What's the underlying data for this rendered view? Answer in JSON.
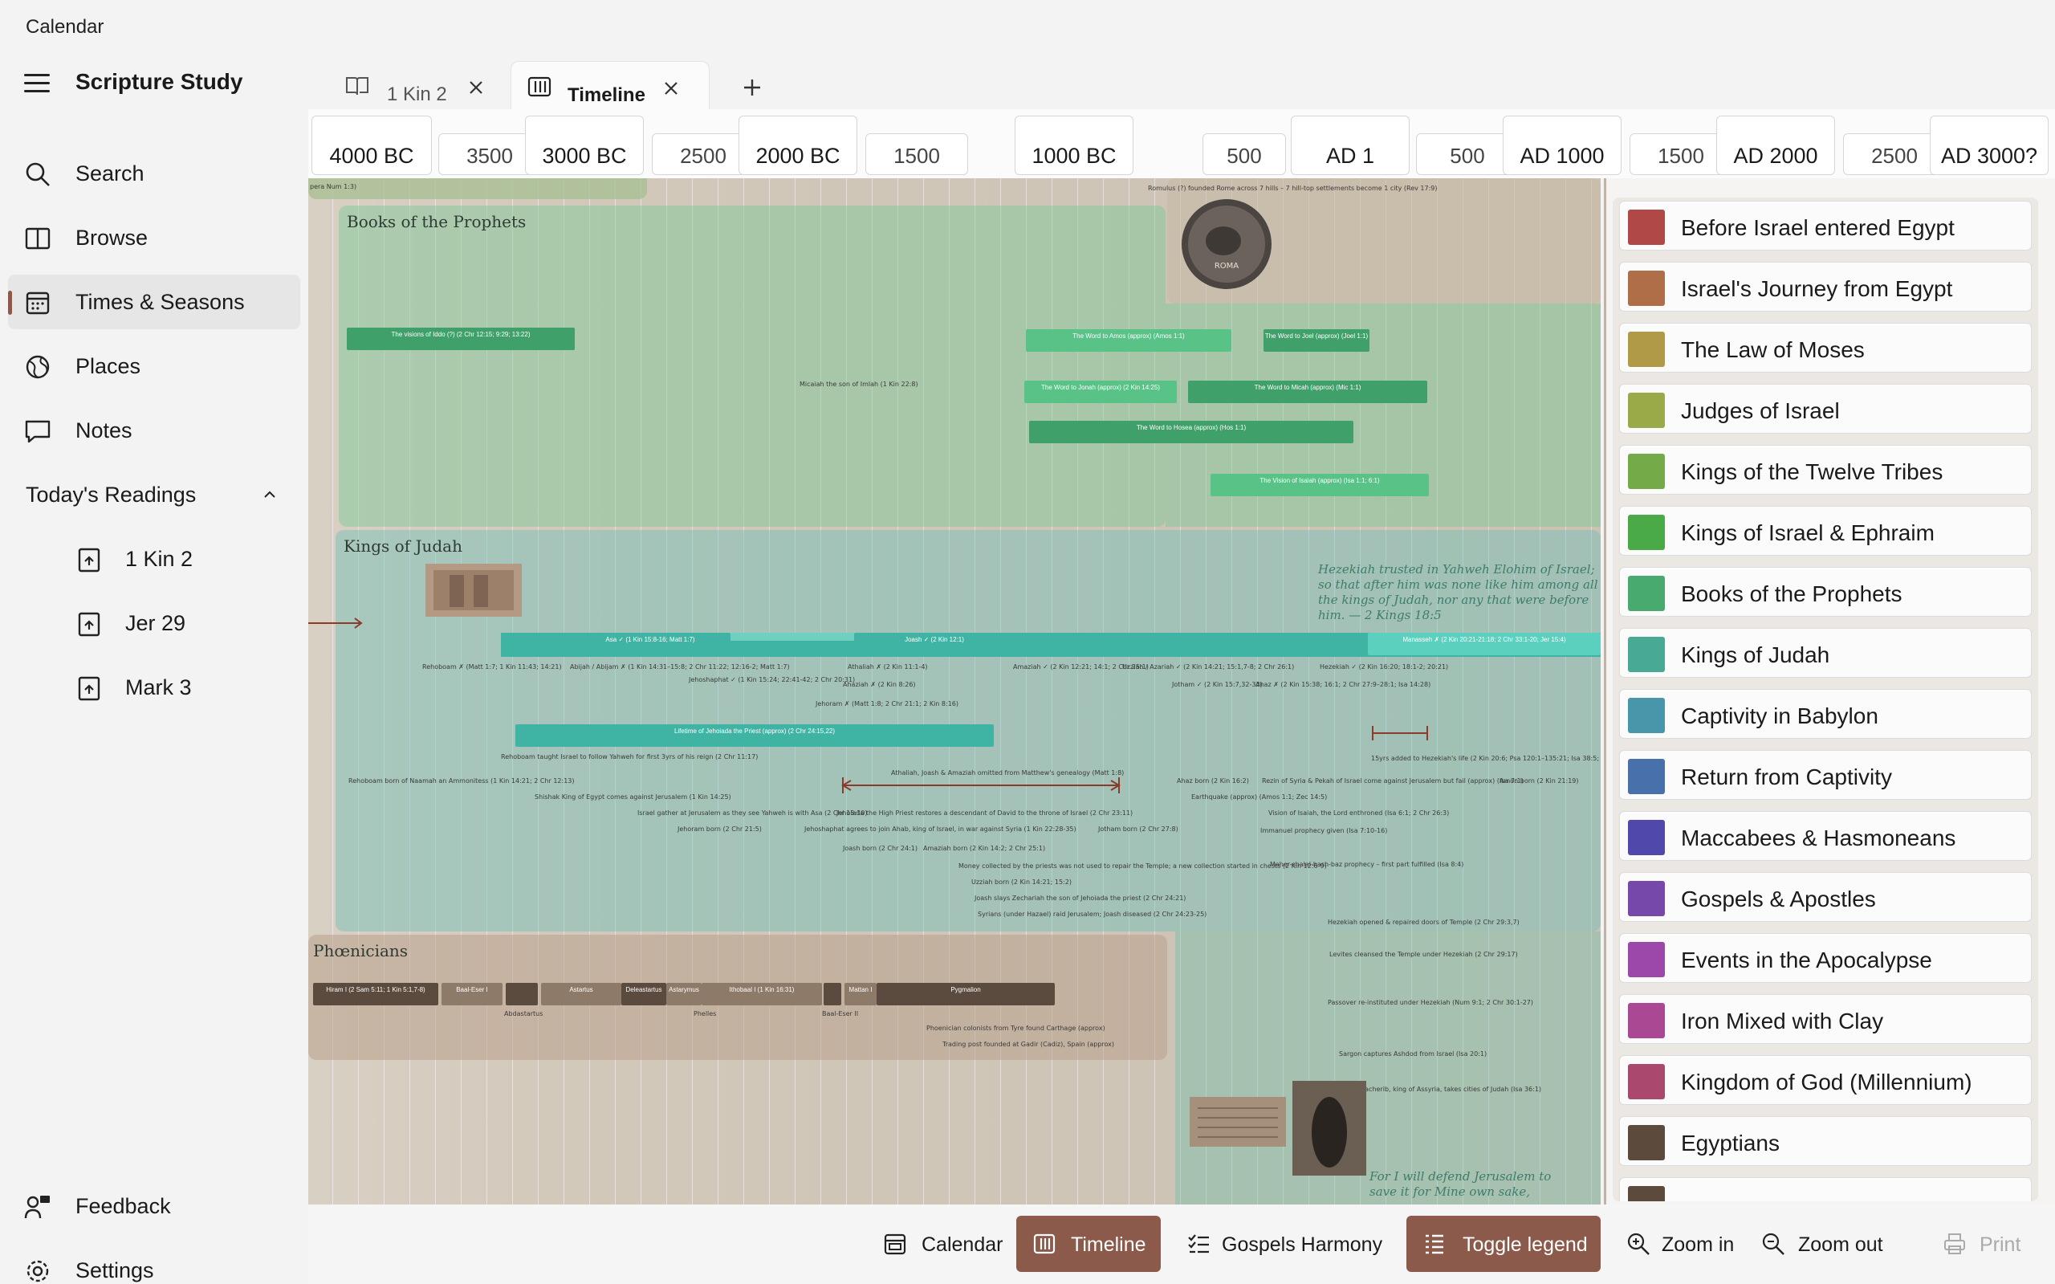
{
  "window": {
    "title": "Calendar"
  },
  "sidebar": {
    "title": "Scripture Study",
    "nav": [
      {
        "label": "Search",
        "icon": "search-icon"
      },
      {
        "label": "Browse",
        "icon": "book-icon"
      },
      {
        "label": "Times & Seasons",
        "icon": "calendar-icon",
        "active": true
      },
      {
        "label": "Places",
        "icon": "globe-icon"
      },
      {
        "label": "Notes",
        "icon": "note-icon"
      }
    ],
    "readings_header": "Today's Readings",
    "readings": [
      {
        "label": "1 Kin 2",
        "icon": "reading-icon"
      },
      {
        "label": "Jer 29",
        "icon": "reading-icon"
      },
      {
        "label": "Mark 3",
        "icon": "reading-icon"
      }
    ],
    "footer": [
      {
        "label": "Feedback",
        "icon": "feedback-icon"
      },
      {
        "label": "Settings",
        "icon": "gear-icon"
      }
    ]
  },
  "tabs": [
    {
      "label": "1 Kin 2",
      "icon": "book-open-icon",
      "active": false
    },
    {
      "label": "Timeline",
      "icon": "timeline-icon",
      "active": true
    }
  ],
  "eras": {
    "major": [
      "4000 BC",
      "3000 BC",
      "2000 BC",
      "1000 BC",
      "AD 1",
      "AD 1000",
      "AD 2000",
      "AD 3000?"
    ],
    "minor": [
      "3500",
      "2500",
      "1500",
      "500",
      "500",
      "1500",
      "2500"
    ]
  },
  "timeline": {
    "bands": {
      "prophets": "Books of the Prophets",
      "judah": "Kings of Judah",
      "phoenicians": "Phœnicians"
    },
    "quotes": {
      "hezekiah": "Hezekiah trusted in Yahweh Elohim of Israel; so that after him was none like him among all the kings of Judah, nor any that were before him. — 2 Kings 18:5",
      "defend": "For I will defend Jerusalem to save it for Mine own sake,"
    },
    "prophet_bars": [
      "The visions of Iddo (?) (2 Chr 12:15; 9:29; 13:22)",
      "The Word to Amos (approx) (Amos 1:1)",
      "The Word to Joel (approx) (Joel 1:1)",
      "The Word to Jonah (approx) (2 Kin 14:25)",
      "The Word to Micah (approx) (Mic 1:1)",
      "The Word to Hosea (approx) (Hos 1:1)",
      "The Vision of Isaiah (approx) (Isa 1:1; 6:1)"
    ],
    "judah_bars": [
      "Asa ✓ (1 Kin 15:8-16; Matt 1:7)",
      "Joash ✓ (2 Kin 12:1)",
      "Manasseh ✗ (2 Kin 20:21-21:18; 2 Chr 33:1-20; Jer 15:4)",
      "Lifetime of Jehoiada the Priest (approx) (2 Chr 24:15,22)"
    ],
    "phoenician_bars": [
      "Hiram I (2 Sam 5:11; 1 Kin 5:1,7-8)",
      "Baal-Eser I",
      "Astartus",
      "Deleastartus",
      "Astarymus",
      "Ithobaal I (1 Kin 16:31)",
      "Mattan I",
      "Pygmalion"
    ],
    "notes": {
      "romulus": "Romulus (?) founded Rome across 7 hills – 7 hill-top settlements become 1 city (Rev 17:9)",
      "mizraim": "Micaiah the son of Imlah (1 Kin 22:8)",
      "rehoboam": "Rehoboam ✗ (Matt 1:7; 1 Kin 11:43; 14:21)",
      "abijah": "Abijah / Abijam ✗ (1 Kin 14:31–15:8; 2 Chr 11:22; 12:16-2; Matt 1:7)",
      "jehoshaphat": "Jehoshaphat ✓ (1 Kin 15:24; 22:41-42; 2 Chr 20:31)",
      "athaliah": "Athaliah ✗ (2 Kin 11:1-4)",
      "ahaziah": "Ahaziah ✗ (2 Kin 8:26)",
      "jehoram": "Jehoram ✗ (Matt 1:8; 2 Chr 21:1; 2 Kin 8:16)",
      "amaziah": "Amaziah ✓ (2 Kin 12:21; 14:1; 2 Chr 25:1)",
      "uzziah": "Uzziah / Azariah ✓ (2 Kin 14:21; 15:1,7-8; 2 Chr 26:1)",
      "jotham": "Jotham ✓ (2 Kin 15:7,32-33)",
      "ahaz": "Ahaz ✗ (2 Kin 15:38; 16:1; 2 Chr 27:9–28:1; Isa 14:28)",
      "hezekiah": "Hezekiah ✓ (2 Kin 16:20; 18:1-2; 20:21)",
      "omitted": "Athaliah, Joash & Amaziah omitted from Matthew's genealogy (Matt 1:8)",
      "years_added": "15yrs added to Hezekiah's life (2 Kin 20:6; Psa 120:1–135:21; Isa 38:5; Isa 2:32)",
      "rehoboam_taught": "Rehoboam taught Israel to follow Yahweh for first 3yrs of his reign (2 Chr 11:17)",
      "rehoboam_born": "Rehoboam born of Naamah an Ammonitess (1 Kin 14:21; 2 Chr 12:13)",
      "shishak": "Shishak King of Egypt comes against Jerusalem (1 Kin 14:25)",
      "israel_gather": "Israel gather at Jerusalem as they see Yahweh is with Asa (2 Chr 15:10)",
      "jehoiada": "Jehoiada the High Priest restores a descendant of David to the throne of Israel (2 Chr 23:11)",
      "jehoshaphat_agrees": "Jehoshaphat agrees to join Ahab, king of Israel, in war against Syria (1 Kin 22:28-35)",
      "jehoram_born": "Jehoram born (2 Chr 21:5)",
      "joash_born": "Joash born (2 Chr 24:1)",
      "amaziah_born": "Amaziah born (2 Kin 14:2; 2 Chr 25:1)",
      "money": "Money collected by the priests was not used to repair the Temple; a new collection started in chests (2 Kin 12:6-9)",
      "uzziah_born": "Uzziah born (2 Kin 14:21; 15:2)",
      "joash_slays": "Joash slays Zechariah the son of Jehoiada the priest (2 Chr 24:21)",
      "syrians": "Syrians (under Hazael) raid Jerusalem; Joash diseased (2 Chr 24:23-25)",
      "ahaz_born": "Ahaz born (2 Kin 16:2)",
      "earthquake": "Earthquake (approx) (Amos 1:1; Zec 14:5)",
      "rezin": "Rezin of Syria & Pekah of Israel come against Jerusalem but fail (approx) (Isa 7:1)",
      "jotham_born": "Jotham born (2 Chr 27:8)",
      "vision_lord": "Vision of Isaiah, the Lord enthroned (Isa 6:1; 2 Chr 26:3)",
      "immanuel": "Immanuel prophecy given (Isa 7:10-16)",
      "maher": "Maher-shalal-hash-baz prophecy – first part fulfilled (Isa 8:4)",
      "amon": "Amon born (2 Kin 21:19)",
      "hezekiah_opened": "Hezekiah opened & repaired doors of Temple (2 Chr 29:3,7)",
      "levites": "Levites cleansed the Temple under Hezekiah (2 Chr 29:17)",
      "passover": "Passover re-instituted under Hezekiah (Num 9:1; 2 Chr 30:1-27)",
      "sargon": "Sargon captures Ashdod from Israel (Isa 20:1)",
      "sennacherib": "Sennacherib, king of Assyria, takes cities of Judah (Isa 36:1)",
      "phoenician_colonists": "Phoenician colonists from Tyre found Carthage (approx)",
      "trading_post": "Trading post founded at Gadir (Cadiz), Spain (approx)",
      "abdastartus": "Abdastartus",
      "phelles": "Phelles",
      "baal_eser": "Baal-Eser II",
      "pera_num": "pera Num 1:3)"
    }
  },
  "legend": [
    {
      "label": "Before Israel entered Egypt",
      "color": "#b04848"
    },
    {
      "label": "Israel's Journey from Egypt",
      "color": "#b06e48"
    },
    {
      "label": "The Law of Moses",
      "color": "#b09a48"
    },
    {
      "label": "Judges of Israel",
      "color": "#9aaa48"
    },
    {
      "label": "Kings of the Twelve Tribes",
      "color": "#74aa48"
    },
    {
      "label": "Kings of Israel & Ephraim",
      "color": "#4aaa48"
    },
    {
      "label": "Books of the Prophets",
      "color": "#48aa6e"
    },
    {
      "label": "Kings of Judah",
      "color": "#48aa94"
    },
    {
      "label": "Captivity in Babylon",
      "color": "#4896aa"
    },
    {
      "label": "Return from Captivity",
      "color": "#4870aa"
    },
    {
      "label": "Maccabees & Hasmoneans",
      "color": "#5048aa"
    },
    {
      "label": "Gospels & Apostles",
      "color": "#7648aa"
    },
    {
      "label": "Events in the Apocalypse",
      "color": "#9c48aa"
    },
    {
      "label": "Iron Mixed with Clay",
      "color": "#aa4894"
    },
    {
      "label": "Kingdom of God (Millennium)",
      "color": "#aa486e"
    },
    {
      "label": "Egyptians",
      "color": "#5c4a3c"
    }
  ],
  "toolbar": [
    {
      "label": "Calendar",
      "icon": "calendar-icon",
      "on": false
    },
    {
      "label": "Timeline",
      "icon": "timeline-icon",
      "on": true
    },
    {
      "label": "Gospels Harmony",
      "icon": "harmony-icon",
      "on": false
    },
    {
      "label": "Toggle legend",
      "icon": "legend-icon",
      "on": true
    },
    {
      "label": "Zoom in",
      "icon": "zoom-in-icon",
      "on": false
    },
    {
      "label": "Zoom out",
      "icon": "zoom-out-icon",
      "on": false
    },
    {
      "label": "Print",
      "icon": "print-icon",
      "on": false,
      "disabled": true
    }
  ]
}
